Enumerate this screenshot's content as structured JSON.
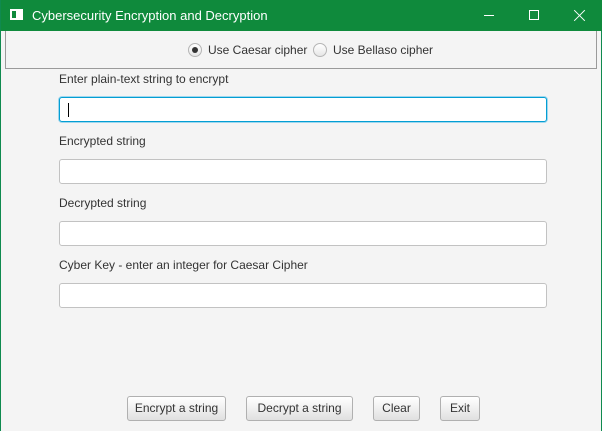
{
  "window": {
    "title": "Cybersecurity Encryption and Decryption",
    "controls": {
      "minimize_icon": "minimize-icon",
      "maximize_icon": "maximize-icon",
      "close_icon": "close-icon"
    },
    "accent_color": "#0f8a3c"
  },
  "cipher_options": {
    "caesar_label": "Use Caesar cipher",
    "caesar_selected": true,
    "bellaso_label": "Use Bellaso cipher",
    "bellaso_selected": false
  },
  "fields": {
    "plain_text": {
      "label": "Enter plain-text string to encrypt",
      "value": ""
    },
    "encrypted": {
      "label": "Encrypted string",
      "value": ""
    },
    "decrypted": {
      "label": "Decrypted string",
      "value": ""
    },
    "key": {
      "label": "Cyber Key - enter an integer for Caesar Cipher",
      "value": ""
    }
  },
  "buttons": {
    "encrypt": "Encrypt a string",
    "decrypt": "Decrypt a string",
    "clear": "Clear",
    "exit": "Exit"
  }
}
